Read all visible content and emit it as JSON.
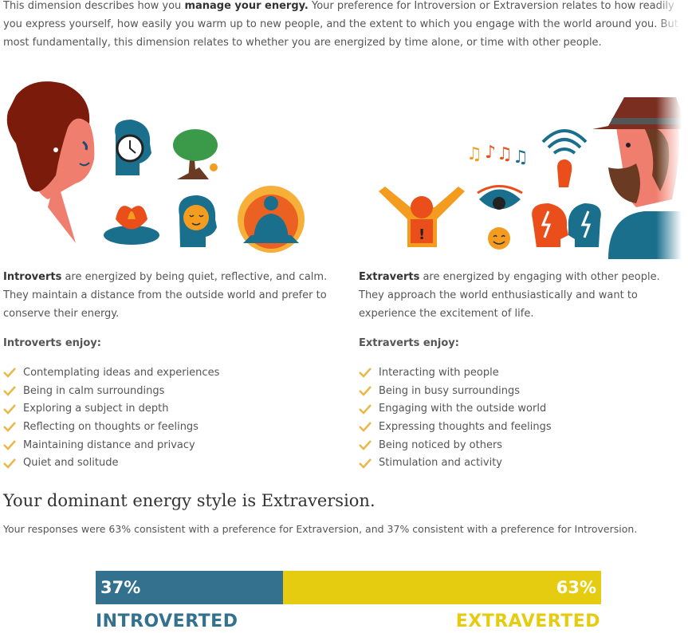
{
  "intro": {
    "part1": "This dimension describes how you ",
    "bold": "manage your energy.",
    "part2": " Your preference for Introversion or Extraversion relates to how readily you express yourself, how easily you warm up to new people, and the extent to which you engage with the world around you. But most fundamentally, this dimension relates to whether you are energized by time alone, or time with other people."
  },
  "introverts": {
    "lead_bold": "Introverts",
    "lead_rest": " are energized by being quiet, reflective, and calm. They maintain a distance from the outside world and prefer to conserve their energy.",
    "enjoy_title": "Introverts enjoy:",
    "items": [
      "Contemplating ideas and experiences",
      "Being in calm surroundings",
      "Exploring a subject in depth",
      "Reflecting on thoughts or feelings",
      "Maintaining distance and privacy",
      "Quiet and solitude"
    ]
  },
  "extraverts": {
    "lead_bold": "Extraverts",
    "lead_rest": " are energized by engaging with other people. They approach the world enthusiastically and want to experience the excitement of life.",
    "enjoy_title": "Extraverts enjoy:",
    "items": [
      "Interacting with people",
      "Being in busy surroundings",
      "Engaging with the outside world",
      "Expressing thoughts and feelings",
      "Being noticed by others",
      "Stimulation and activity"
    ]
  },
  "result": {
    "heading": "Your dominant energy style is Extraversion.",
    "responses": "Your responses were 63% consistent with a preference for Extraversion, and 37% consistent with a preference for Introversion.",
    "introvert_pct_label": "37%",
    "extravert_pct_label": "63%",
    "introvert_fraction": 0.37,
    "extravert_fraction": 0.63,
    "introvert_label": "INTROVERTED",
    "extravert_label": "EXTRAVERTED"
  },
  "colors": {
    "introvert": "#33718e",
    "extravert": "#e6cc10",
    "check": "#e8b84a"
  },
  "icons": {
    "introvert_illustration": [
      "woman-profile",
      "clock-head-icon",
      "tree-icon",
      "lotus-icon",
      "calm-face-head-icon",
      "meditation-icon"
    ],
    "extravert_illustration": [
      "cheering-person-icon",
      "music-notes-icon",
      "signal-head-icon",
      "eye-icon",
      "smile-icon",
      "talking-heads-icon",
      "bearded-man-profile"
    ]
  }
}
